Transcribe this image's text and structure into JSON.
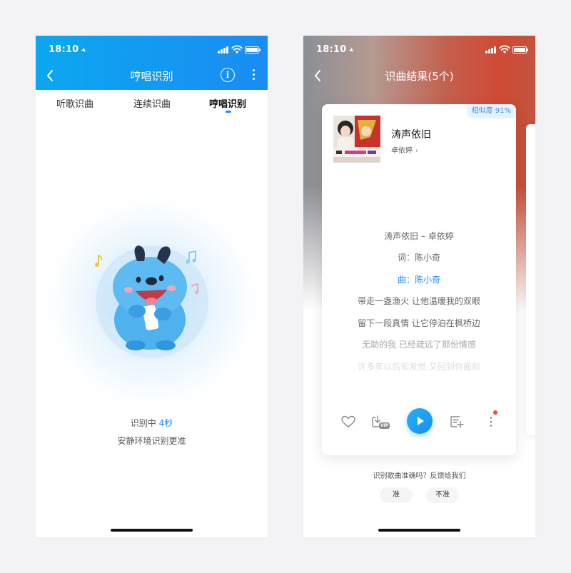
{
  "left_screen": {
    "status_time": "18:10",
    "title": "哼唱识别",
    "info_icon": "info-circle-icon",
    "tabs": [
      {
        "label": "听歌识曲",
        "active": false
      },
      {
        "label": "连续识曲",
        "active": false
      },
      {
        "label": "哼唱识别",
        "active": true
      }
    ],
    "status_prefix": "识别中",
    "status_time_value": "4秒",
    "hint": "安静环境识别更准"
  },
  "right_screen": {
    "status_time": "18:10",
    "title": "识曲结果(5个)",
    "card": {
      "similarity": "相似度 91%",
      "song_title": "涛声依旧",
      "artist": "卓依婷",
      "lyrics": [
        {
          "text": "涛声依旧 – 卓依婷",
          "active": false
        },
        {
          "text": "词：陈小奇",
          "active": false
        },
        {
          "text": "曲：陈小奇",
          "active": true
        },
        {
          "text": "带走一盏渔火 让他温暖我的双眼",
          "active": false
        },
        {
          "text": "留下一段真情 让它停泊在枫桥边",
          "active": false
        },
        {
          "text": "无助的我 已经疏远了那份情感",
          "active": false
        },
        {
          "text": "许多年以后却发觉 又回到你面前",
          "active": false
        }
      ],
      "vip_label": "VIP",
      "controls": [
        "heart-icon",
        "download-vip-icon",
        "play-icon",
        "add-to-playlist-icon",
        "more-vertical-icon"
      ]
    },
    "feedback_question": "识别歌曲准确吗？反馈给我们",
    "feedback_yes": "准",
    "feedback_no": "不准"
  },
  "colors": {
    "accent": "#1a8cf3",
    "header_gradient": [
      "#0ca7f0",
      "#1a8cf3"
    ],
    "notification_dot": "#f04a4a"
  }
}
